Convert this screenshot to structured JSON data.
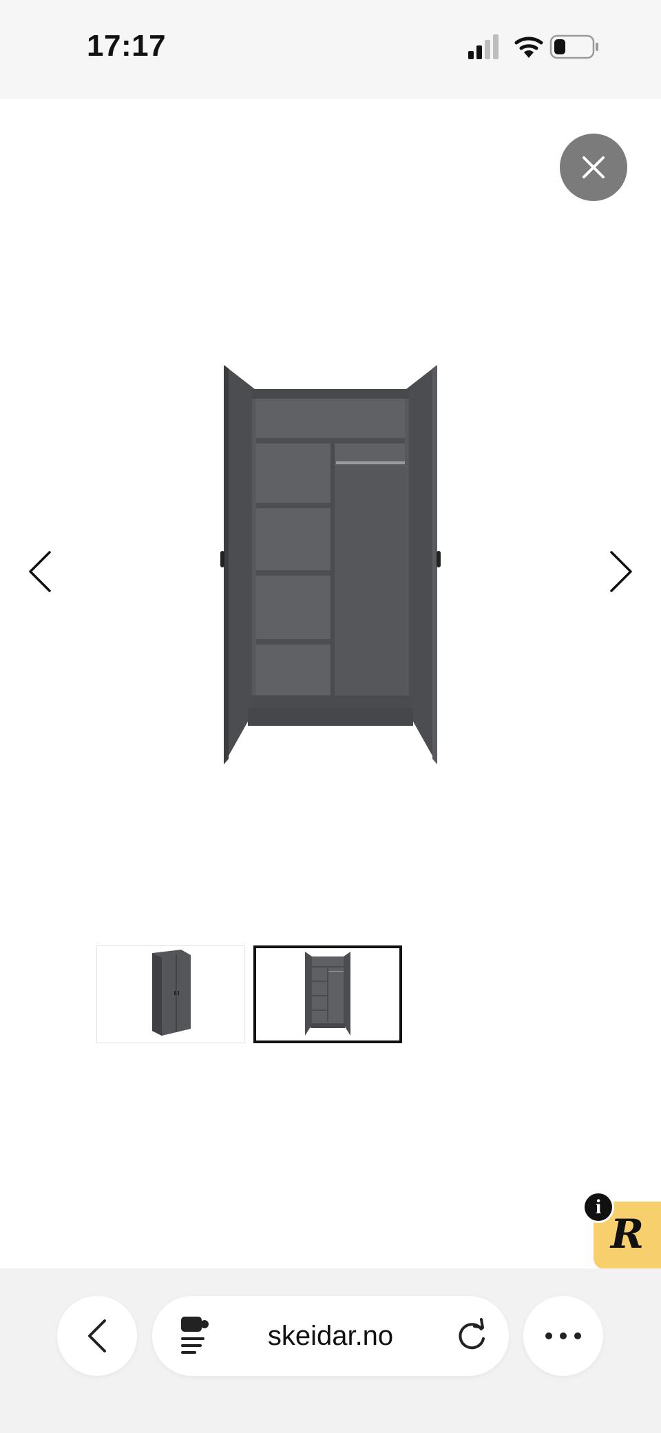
{
  "status_bar": {
    "time": "17:17"
  },
  "gallery": {
    "main_image_icon": "wardrobe-open-doors",
    "thumbnails": [
      {
        "icon": "wardrobe-closed",
        "selected": false
      },
      {
        "icon": "wardrobe-open",
        "selected": true
      }
    ],
    "product_color": "#4a4b4d"
  },
  "badge": {
    "letter": "R",
    "info": "i",
    "color": "#f7cf6c"
  },
  "browser": {
    "url": "skeidar.no"
  }
}
